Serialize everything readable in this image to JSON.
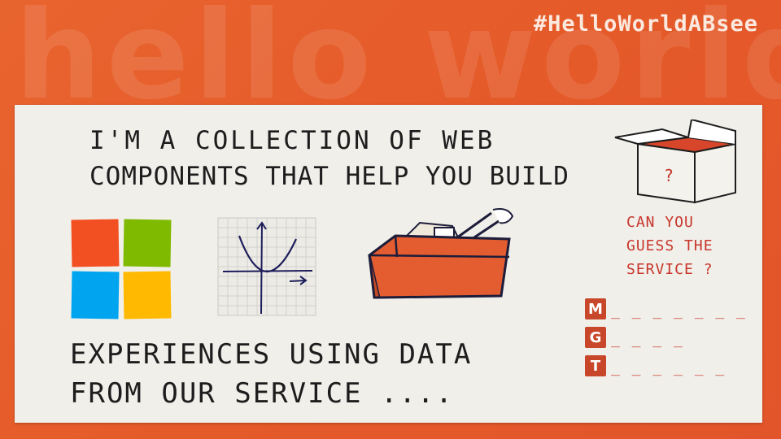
{
  "background_word": "hello world",
  "hashtag": "#HelloWorldABsee",
  "headline": {
    "line1": "I'm a collection of web",
    "line2": "components that help you build"
  },
  "footer": {
    "line1": "Experiences using data",
    "line2": "from our service ...."
  },
  "question": {
    "line1": "CAN YOU",
    "line2": "GUESS THE",
    "line3": "SERVICE ?"
  },
  "box_mark": "?",
  "hints": [
    {
      "letter": "M",
      "blanks": "_ _ _ _ _ _ _"
    },
    {
      "letter": "G",
      "blanks": "_ _ _ _"
    },
    {
      "letter": "T",
      "blanks": "_ _ _ _ _ _"
    }
  ],
  "colors": {
    "background": "#e55a29",
    "card": "#f1efea",
    "accent_red": "#c7352a",
    "logo_red": "#f25022",
    "logo_green": "#7fba00",
    "logo_blue": "#00a4ef",
    "logo_yellow": "#ffb900",
    "toolbox": "#e35d31"
  },
  "icons": [
    "microsoft-logo-icon",
    "graph-icon",
    "toolbox-icon",
    "mystery-box-icon"
  ]
}
